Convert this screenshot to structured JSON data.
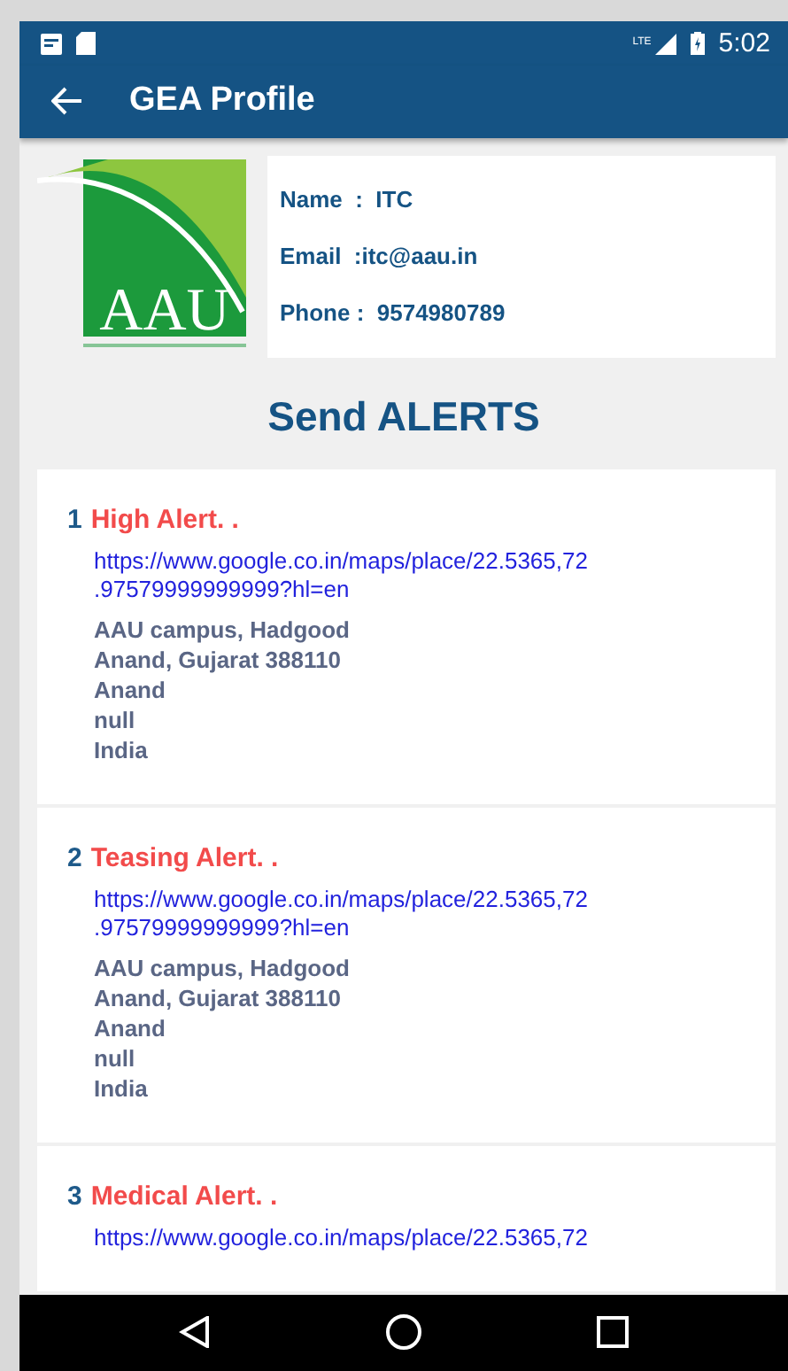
{
  "status_bar": {
    "time": "5:02",
    "network": "LTE"
  },
  "app_bar": {
    "title": "GEA Profile"
  },
  "profile": {
    "logo_text": "AAU",
    "fields": [
      {
        "label": "Name",
        "value": "ITC",
        "sep": "  :  "
      },
      {
        "label": "Email",
        "value": "itc@aau.in",
        "sep": "  :"
      },
      {
        "label": "Phone",
        "value": "9574980789",
        "sep": " :  "
      }
    ]
  },
  "section_title": "Send ALERTS",
  "alerts": [
    {
      "number": "1",
      "title": "High Alert. .",
      "link": "https://www.google.co.in/maps/place/22.5365,72\n.97579999999999?hl=en",
      "address": [
        "AAU campus, Hadgood",
        "Anand, Gujarat 388110",
        "Anand",
        "null",
        "India"
      ]
    },
    {
      "number": "2",
      "title": "Teasing Alert. .",
      "link": "https://www.google.co.in/maps/place/22.5365,72\n.97579999999999?hl=en",
      "address": [
        "AAU campus, Hadgood",
        "Anand, Gujarat 388110",
        "Anand",
        "null",
        "India"
      ]
    },
    {
      "number": "3",
      "title": "Medical Alert. .",
      "link": "https://www.google.co.in/maps/place/22.5365,72"
    }
  ]
}
